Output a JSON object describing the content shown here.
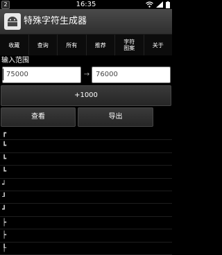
{
  "status_bar": {
    "badge": "2",
    "time": "16:35"
  },
  "app": {
    "title": "特殊字符生成器"
  },
  "tabs": [
    "收藏",
    "查询",
    "所有",
    "推荐",
    "字符\n图案",
    "关于"
  ],
  "range": {
    "label": "输入范围",
    "from": "75000",
    "arrow": "→",
    "to": "76000"
  },
  "buttons": {
    "plus": "+1000",
    "view": "查看",
    "export": "导出"
  },
  "chars": [
    "┏",
    "┗",
    "┗",
    "┗",
    "┙",
    "┚",
    "┛",
    "┝",
    "┝",
    "┞"
  ],
  "colors": {
    "background": "#000000",
    "title_bar": "#3c3c3c",
    "button": "#303030",
    "input_text": "#444444"
  }
}
